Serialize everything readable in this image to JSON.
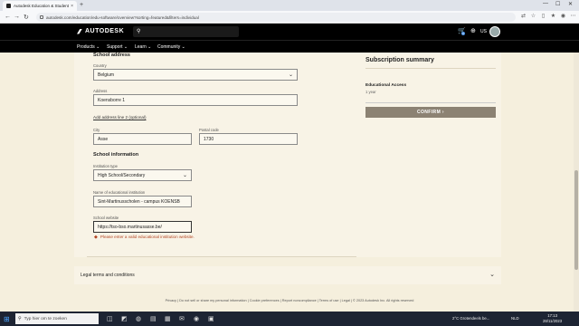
{
  "browser": {
    "tab_title": "Autodesk Education & Student",
    "tab_close": "×",
    "new_tab": "+",
    "url": "autodesk.com/education/edu-software/overview?sorting=featured&filters=individual"
  },
  "header": {
    "brand": "AUTODESK",
    "region": "US",
    "cart_count": "0",
    "nav": [
      "Products ⌄",
      "Support ⌄",
      "Learn ⌄",
      "Community ⌄"
    ]
  },
  "form": {
    "school_address_title": "School address",
    "country_label": "Country",
    "country_value": "Belgium",
    "address_label": "Address",
    "address_value": "Koensborre 1",
    "add_line_link": "Add address line 2 (optional)",
    "city_label": "City",
    "city_value": "Asse",
    "postal_label": "Postal code",
    "postal_value": "1730",
    "school_info_title": "School information",
    "type_label": "Institution type",
    "type_value": "High School/Secondary",
    "name_label": "Name of educational institution",
    "name_value": "Sint-Martinusscholen - campus KOENSB",
    "website_label": "School website",
    "website_value": "https://tso-bso.martinusasse.be/",
    "error_text": "Please enter a valid educational institution website."
  },
  "summary": {
    "title": "Subscription summary",
    "product": "Educational Access",
    "term": "1 year",
    "confirm_label": "CONFIRM  ›"
  },
  "legal": {
    "title": "Legal terms and conditions"
  },
  "footer": {
    "text": "Privacy | Do not sell or share my personal information | Cookie preferences | Report noncompliance | Terms of use | Legal | © 2023 Autodesk Inc. All rights reserved"
  },
  "taskbar": {
    "search_placeholder": "Typ hier om te zoeken",
    "weather": "2°C  Grotendeels be...",
    "language": "NLD",
    "time": "17:13",
    "date": "28/11/2023"
  },
  "colors": {
    "page_bg": "#f5efdd",
    "header_bg": "#000000",
    "confirm_bg": "#8c8273",
    "error": "#b24422"
  }
}
